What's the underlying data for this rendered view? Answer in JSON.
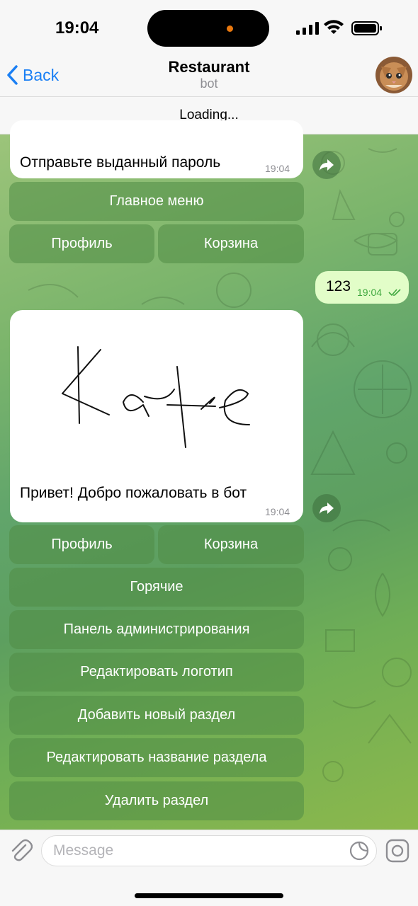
{
  "status": {
    "time": "19:04"
  },
  "nav": {
    "back_label": "Back",
    "title": "Restaurant",
    "subtitle": "bot"
  },
  "banner": {
    "text": "Loading..."
  },
  "messages": [
    {
      "direction": "in",
      "text": "Отправьте выданный пароль",
      "time": "19:04"
    },
    {
      "direction": "out",
      "text": "123",
      "time": "19:04",
      "status": "read"
    },
    {
      "direction": "in",
      "image": "logo-sketch",
      "text": "Привет! Добро пожаловать в бот",
      "time": "19:04"
    }
  ],
  "keyboard1": {
    "main_menu": "Главное меню",
    "profile": "Профиль",
    "cart": "Корзина"
  },
  "keyboard2": {
    "profile": "Профиль",
    "cart": "Корзина",
    "hot": "Горячие",
    "admin_panel": "Панель администрирования",
    "edit_logo": "Редактировать логотип",
    "add_section": "Добавить новый раздел",
    "rename_section": "Редактировать название раздела",
    "delete_section": "Удалить раздел"
  },
  "composer": {
    "placeholder": "Message"
  },
  "icons": [
    "chevron-left-icon",
    "forward-icon",
    "paperclip-icon",
    "sticker-icon",
    "camera-icon",
    "double-check-icon"
  ],
  "colors": {
    "accent": "#1a7ff4",
    "out_bubble": "#e2fdc8",
    "check_green": "#3fa83f"
  }
}
